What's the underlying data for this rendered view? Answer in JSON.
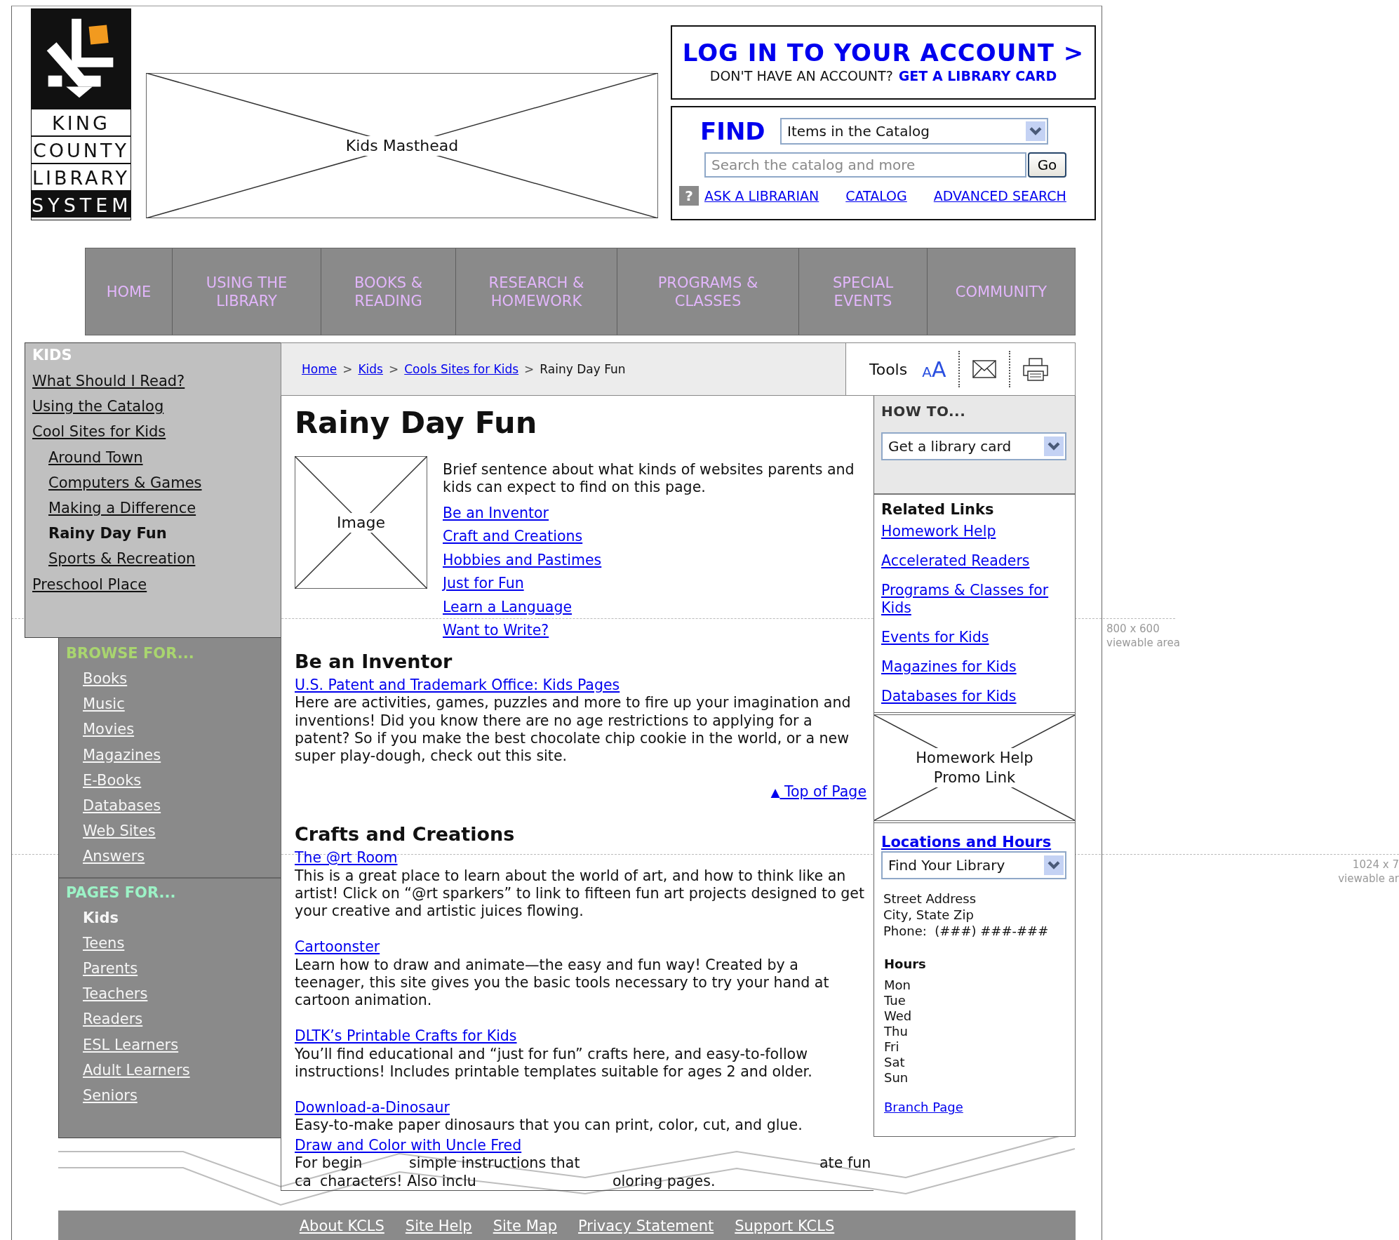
{
  "logo": {
    "lines": [
      "KING",
      "COUNTY",
      "LIBRARY",
      "SYSTEM"
    ]
  },
  "masthead": {
    "label": "Kids Masthead"
  },
  "account": {
    "title": "LOG IN TO YOUR ACCOUNT >",
    "prompt": "DON'T HAVE AN ACCOUNT?",
    "link": "GET A LIBRARY CARD"
  },
  "find": {
    "label": "FIND",
    "scope": "Items in the Catalog",
    "placeholder": "Search the catalog and more",
    "button": "Go",
    "help_icon": "?",
    "links": [
      "ASK A LIBRARIAN",
      "CATALOG",
      "ADVANCED SEARCH"
    ]
  },
  "nav": [
    {
      "lines": [
        "HOME"
      ]
    },
    {
      "lines": [
        "USING THE",
        "LIBRARY"
      ]
    },
    {
      "lines": [
        "BOOKS &",
        "READING"
      ]
    },
    {
      "lines": [
        "RESEARCH &",
        "HOMEWORK"
      ]
    },
    {
      "lines": [
        "PROGRAMS &",
        "CLASSES"
      ]
    },
    {
      "lines": [
        "SPECIAL",
        "EVENTS"
      ]
    },
    {
      "lines": [
        "COMMUNITY"
      ]
    }
  ],
  "sidebar": {
    "title": "KIDS",
    "items": [
      {
        "label": "What Should I Read?",
        "selected": false
      },
      {
        "label": "Using the Catalog",
        "selected": false
      },
      {
        "label": "Cool Sites for Kids",
        "selected": false,
        "children": [
          {
            "label": "Around Town",
            "selected": false
          },
          {
            "label": "Computers & Games",
            "selected": false
          },
          {
            "label": "Making a Difference",
            "selected": false
          },
          {
            "label": "Rainy Day Fun",
            "selected": true
          },
          {
            "label": "Sports & Recreation",
            "selected": false
          }
        ]
      },
      {
        "label": "Preschool Place",
        "selected": false
      }
    ]
  },
  "browse": {
    "title": "BROWSE FOR...",
    "items": [
      "Books",
      "Music",
      "Movies",
      "Magazines",
      "E-Books",
      "Databases",
      "Web Sites",
      "Answers"
    ]
  },
  "pages_for": {
    "title": "PAGES FOR...",
    "items": [
      {
        "label": "Kids",
        "selected": true
      },
      {
        "label": "Teens",
        "selected": false
      },
      {
        "label": "Parents",
        "selected": false
      },
      {
        "label": "Teachers",
        "selected": false
      },
      {
        "label": "Readers",
        "selected": false
      },
      {
        "label": "ESL Learners",
        "selected": false
      },
      {
        "label": "Adult Learners",
        "selected": false
      },
      {
        "label": "Seniors",
        "selected": false
      }
    ]
  },
  "breadcrumb": {
    "separator": ">",
    "items": [
      {
        "label": "Home",
        "link": true
      },
      {
        "label": "Kids",
        "link": true
      },
      {
        "label": "Cools Sites for Kids",
        "link": true
      },
      {
        "label": "Rainy Day Fun",
        "link": false
      }
    ]
  },
  "tools": {
    "label": "Tools",
    "text_size": [
      "A",
      "A"
    ]
  },
  "article": {
    "title": "Rainy Day Fun",
    "image_label": "Image",
    "intro": "Brief sentence about what kinds of websites parents and kids can expect to find on this page.",
    "jump_links": [
      "Be an Inventor",
      "Craft and Creations",
      "Hobbies and Pastimes",
      "Just for Fun",
      "Learn a Language",
      "Want to Write?"
    ],
    "sections": [
      {
        "heading": "Be an Inventor",
        "top_icon": "▲",
        "top_link": "Top of Page",
        "entries": [
          {
            "link": "U.S. Patent and Trademark Office: Kids Pages",
            "text": "Here are activities, games, puzzles and more to fire up your imagination and inventions! Did you know there are no age restrictions to applying for a patent? So if you make the best chocolate chip cookie in the world, or a new super play-dough, check out this site."
          }
        ]
      },
      {
        "heading": "Crafts and Creations",
        "entries": [
          {
            "link": "The @rt Room",
            "text": "This is a great place to learn about the world of art, and how to think like an artist! Click on “@rt sparkers” to link to fifteen fun art projects designed to get your creative and artistic juices flowing."
          },
          {
            "link": "Cartoonster",
            "text": "Learn how to draw and animate—the easy and fun way! Created by a teenager, this site gives you the basic tools necessary to try your hand at cartoon animation."
          },
          {
            "link": "DLTK’s Printable Crafts for Kids",
            "text": "You’ll find educational and “just for fun” crafts here, and easy-to-follow instructions! Includes printable templates suitable for ages 2 and older."
          },
          {
            "link": "Download-a-Dinosaur",
            "text": "Easy-to-make paper dinosaurs that you can print, color, cut, and glue."
          }
        ]
      }
    ],
    "cut_entry": {
      "link": "Draw and Color with Uncle Fred",
      "fragments": [
        [
          "For begin",
          "simple instructions that",
          "ate fun"
        ],
        [
          "ca",
          "characters! Also inclu",
          "oloring pages."
        ]
      ]
    }
  },
  "how_to": {
    "title": "HOW TO...",
    "value": "Get a library card"
  },
  "related": {
    "title": "Related Links",
    "links": [
      "Homework Help",
      "Accelerated Readers",
      "Programs & Classes for Kids",
      "Events for Kids",
      "Magazines for Kids",
      "Databases for Kids"
    ]
  },
  "promo": {
    "label": "Homework Help Promo Link"
  },
  "locations": {
    "title": "Locations and Hours",
    "value": "Find Your Library",
    "address": [
      "Street Address",
      "City, State Zip",
      "Phone:  (###) ###-###"
    ],
    "hours_title": "Hours",
    "days": [
      "Mon",
      "Tue",
      "Wed",
      "Thu",
      "Fri",
      "Sat",
      "Sun"
    ],
    "branch_link": "Branch Page"
  },
  "footer": [
    "About KCLS",
    "Site Help",
    "Site Map",
    "Privacy Statement",
    "Support KCLS"
  ],
  "viewport_marks": [
    {
      "lines": [
        "800 x 600",
        "viewable area"
      ]
    },
    {
      "lines": [
        "1024 x 7",
        "viewable ar"
      ]
    }
  ]
}
